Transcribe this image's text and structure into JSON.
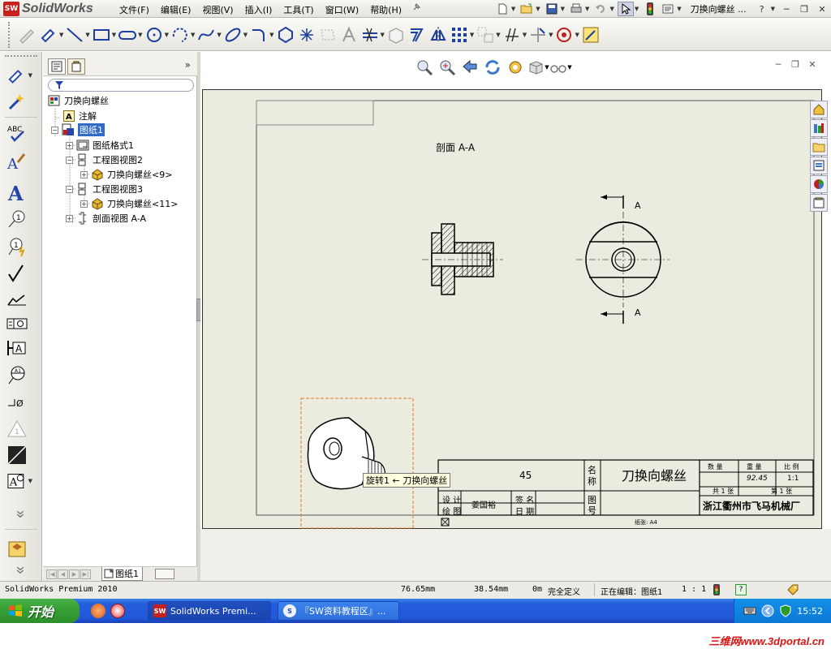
{
  "app": {
    "logo_text": "SolidWorks",
    "logo_badge": "SW",
    "doc_title": "刀换向螺丝 ...",
    "help": "?"
  },
  "menus": [
    "文件(F)",
    "编辑(E)",
    "视图(V)",
    "插入(I)",
    "工具(T)",
    "窗口(W)",
    "帮助(H)"
  ],
  "feature_manager": {
    "root": "刀换向螺丝",
    "items": [
      {
        "label": "注解"
      },
      {
        "label": "图纸1"
      },
      {
        "label": "图纸格式1"
      },
      {
        "label": "工程图视图2"
      },
      {
        "label": "刀换向螺丝<9>"
      },
      {
        "label": "工程图视图3"
      },
      {
        "label": "刀换向螺丝<11>"
      },
      {
        "label": "剖面视图 A-A"
      }
    ],
    "sheet_tab": "图纸1",
    "expand": "»"
  },
  "drawing": {
    "section_title": "剖面 A-A",
    "section_label_top": "A",
    "section_label_bottom": "A",
    "tooltip": "旋转1 ← 刀换向螺丝",
    "title_block": {
      "material": "45",
      "name_label_1": "名",
      "name_label_2": "称",
      "part_name": "刀换向螺丝",
      "drawing_no_label_1": "图",
      "drawing_no_label_2": "号",
      "design": "设 计",
      "draw": "绘 图",
      "author": "姜国裕",
      "sign": "签 名",
      "date": "日 期",
      "qty_label": "数 量",
      "weight_label": "重 量",
      "scale_label": "比 例",
      "weight": "92.45",
      "scale": "1:1",
      "sheet_count_1": "共 1 张",
      "sheet_count_2": "第 1 张",
      "company": "浙江衢州市飞马机械厂",
      "paper": "纸张: A4"
    }
  },
  "status": {
    "product": "SolidWorks Premium 2010",
    "x": "76.65mm",
    "y": "38.54mm",
    "z": "0m",
    "state": "完全定义",
    "editing": "正在编辑：图纸1",
    "scale": "1 : 1",
    "help": "?"
  },
  "taskbar": {
    "start": "开始",
    "tasks": [
      "SolidWorks Premi...",
      "『SW资料教程区』..."
    ],
    "clock": "15:52"
  },
  "watermark": "三维网www.3dportal.cn",
  "colors": {
    "sheet_bg": "#ecebdf",
    "selection": "#316ac5",
    "tooltip_bg": "#ffffe1",
    "taskbar": "#245edc",
    "start_button": "#37a035",
    "watermark": "#d81414"
  }
}
